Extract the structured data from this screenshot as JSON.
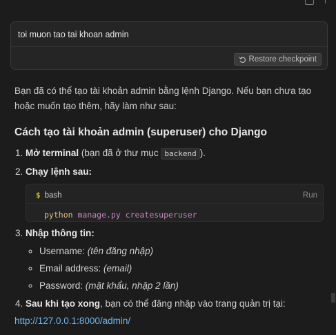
{
  "prompt": {
    "text": "toi muon tao tai khoan admin",
    "restore_label": "Restore checkpoint"
  },
  "response": {
    "intro": "Bạn đã có thể tạo tài khoản admin bằng lệnh Django. Nếu bạn chưa tạo hoặc muốn tạo thêm, hãy làm như sau:",
    "heading": "Cách tạo tài khoản admin (superuser) cho Django",
    "step1": {
      "bold": "Mở terminal",
      "text_a": " (bạn đã ở thư mục ",
      "code": "backend",
      "text_b": ")."
    },
    "step2": {
      "bold": "Chạy lệnh sau:"
    },
    "codeblock": {
      "lang": "bash",
      "run_label": "Run",
      "cmd": "python",
      "args": " manage.py createsuperuser"
    },
    "step3": {
      "bold": "Nhập thông tin:",
      "items": [
        {
          "label": "Username: ",
          "hint": "(tên đăng nhập)"
        },
        {
          "label": "Email address: ",
          "hint": "(email)"
        },
        {
          "label": "Password: ",
          "hint": "(mật khẩu, nhập 2 lần)"
        }
      ]
    },
    "step4": {
      "bold": "Sau khi tạo xong",
      "text": ", bạn có thể đăng nhập vào trang quản trị tại:"
    },
    "link": "http://127.0.0.1:8000/admin/"
  }
}
